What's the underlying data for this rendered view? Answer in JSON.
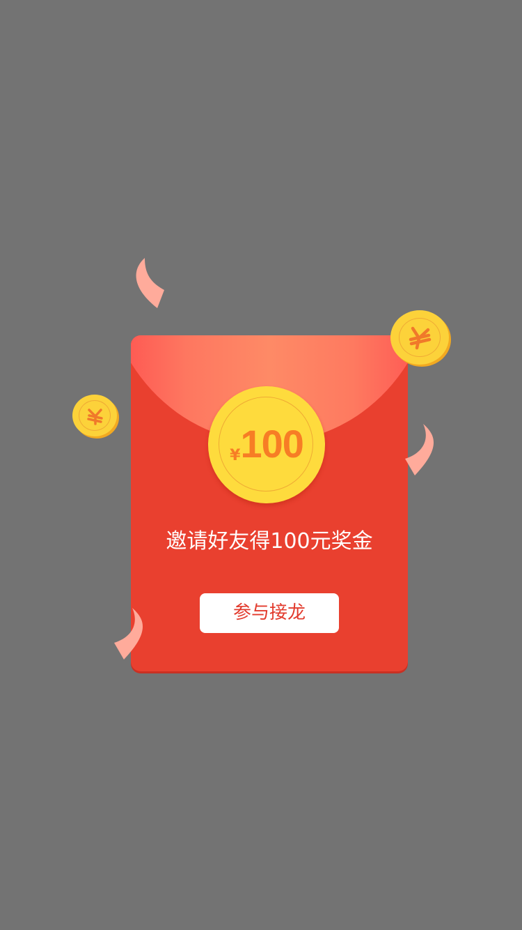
{
  "red_packet": {
    "currency_symbol": "¥",
    "amount": "100",
    "invite_text": "邀请好友得100元奖金",
    "join_button_label": "参与接龙"
  },
  "icons": {
    "decorative_coins": [
      "yen-coin-icon",
      "yen-coin-icon"
    ],
    "confetti": [
      "confetti-icon",
      "confetti-icon",
      "confetti-icon"
    ]
  },
  "colors": {
    "backdrop": "#737373",
    "envelope_red": "#e9402f",
    "coin_gold": "#fedb3d",
    "coin_text_orange": "#f77d25",
    "button_text_red": "#e23a2c",
    "confetti_pink": "#ffab9b"
  }
}
